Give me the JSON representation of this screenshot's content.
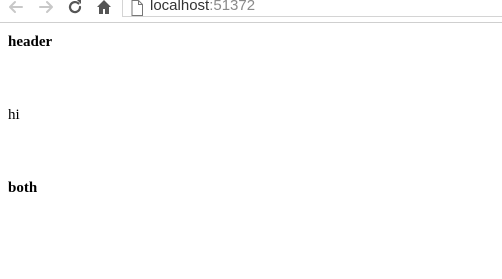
{
  "browser": {
    "address": {
      "host": "localhost",
      "port_suffix": ":51372"
    },
    "icons": {
      "back": "back-arrow-icon",
      "forward": "forward-arrow-icon",
      "reload": "reload-icon",
      "home": "home-icon",
      "page": "page-icon"
    },
    "colors": {
      "icon_disabled": "#c8c8c8",
      "icon_active": "#555555",
      "url_host": "#333333",
      "url_port": "#8a8a8a"
    }
  },
  "page": {
    "lines": [
      {
        "text": "header",
        "bold": true
      },
      {
        "text": "hi",
        "bold": false
      },
      {
        "text": "both",
        "bold": true
      }
    ]
  }
}
